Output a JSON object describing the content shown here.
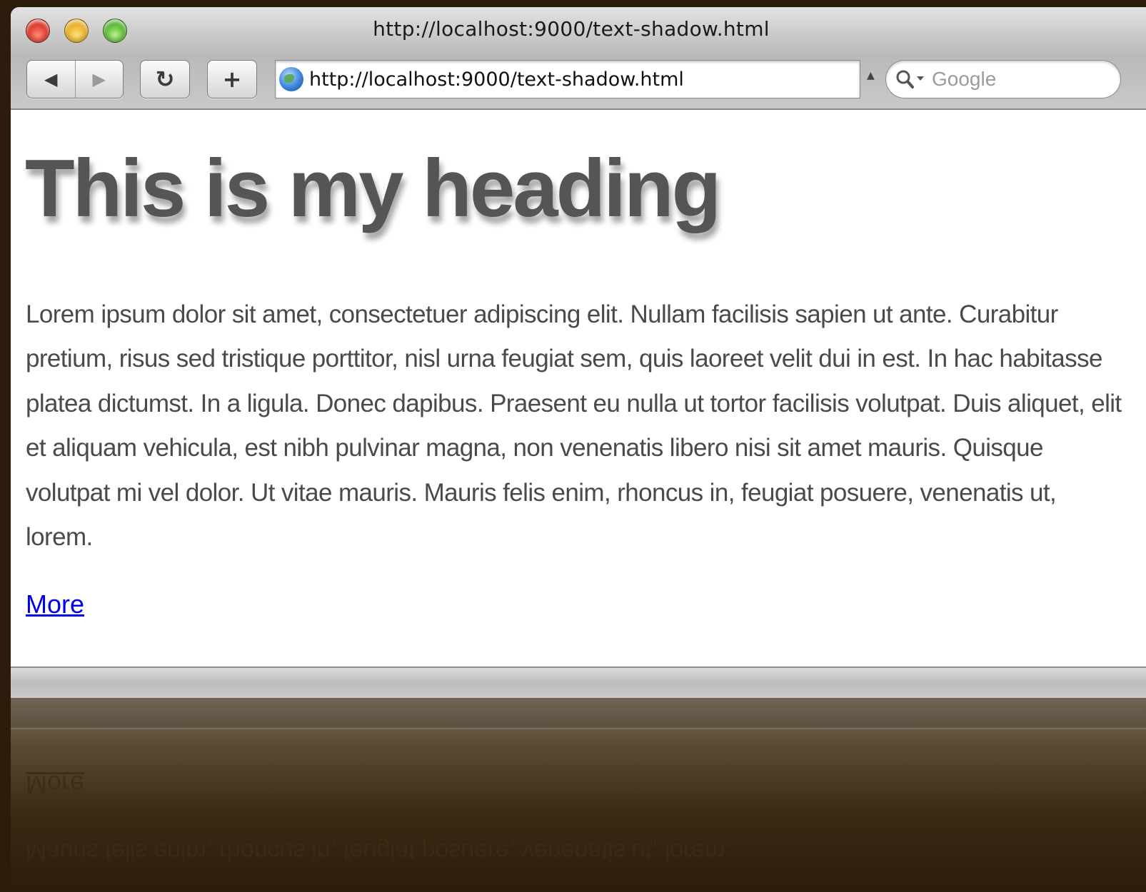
{
  "window": {
    "title": "http://localhost:9000/text-shadow.html"
  },
  "toolbar": {
    "back_icon": "back-arrow-icon",
    "forward_icon": "forward-arrow-icon",
    "reload_glyph": "↻",
    "add_glyph": "+",
    "url": "http://localhost:9000/text-shadow.html",
    "search_placeholder": "Google"
  },
  "page": {
    "heading": "This is my heading",
    "paragraph": "Lorem ipsum dolor sit amet, consectetuer adipiscing elit. Nullam facilisis sapien ut ante. Curabitur pretium, risus sed tristique porttitor, nisl urna feugiat sem, quis laoreet velit dui in est. In hac habitasse platea dictumst. In a ligula. Donec dapibus. Praesent eu nulla ut tortor facilisis volutpat. Duis aliquet, elit et aliquam vehicula, est nibh pulvinar magna, non venenatis libero nisi sit amet mauris. Quisque volutpat mi vel dolor. Ut vitae mauris. Mauris felis enim, rhoncus in, feugiat posuere, venenatis ut, lorem.",
    "link": "More"
  },
  "reflection": {
    "link": "More",
    "last_line": "Mauris felis enim, rhoncus in, feugiat posuere, venenatis ut, lorem."
  },
  "colors": {
    "desktop": "#2b1c0c",
    "heading": "#555555",
    "body_text": "#4a4a4a",
    "link": "#0000ee"
  }
}
